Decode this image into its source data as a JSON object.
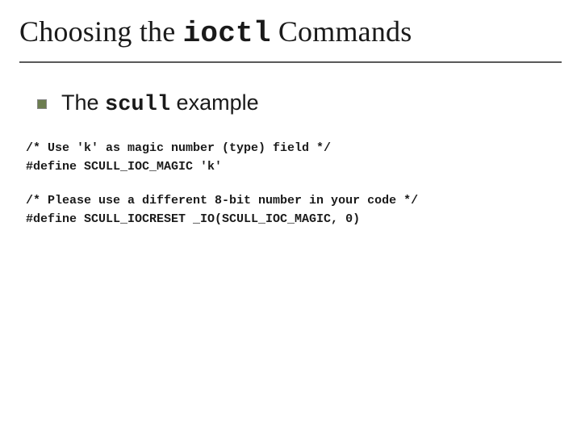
{
  "title": {
    "part1": "Choosing the ",
    "mono": "ioctl",
    "part2": " Commands"
  },
  "subItem": {
    "part1": "The ",
    "mono": "scull",
    "part2": " example"
  },
  "code1": {
    "line1": "/* Use 'k' as magic number (type) field */",
    "line2": "#define SCULL_IOC_MAGIC 'k'"
  },
  "code2": {
    "line1": "/* Please use a different 8-bit number in your code */",
    "line2": "#define SCULL_IOCRESET _IO(SCULL_IOC_MAGIC, 0)"
  }
}
